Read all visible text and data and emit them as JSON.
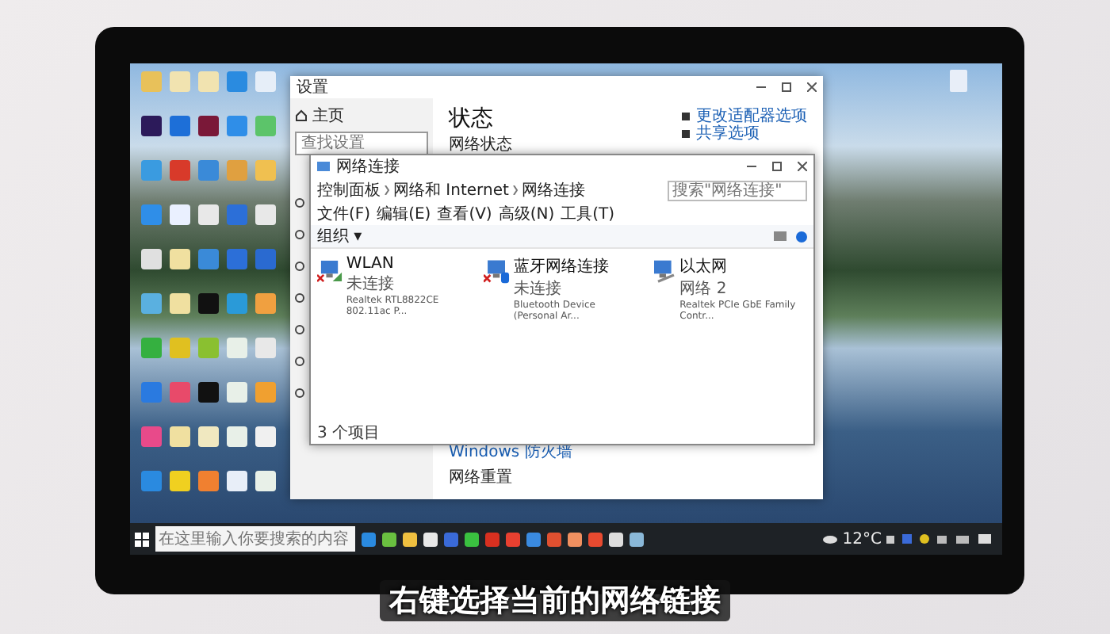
{
  "settings_window": {
    "title": "设置",
    "home": "主页",
    "search_placeholder": "查找设置",
    "heading": "状态",
    "subheading": "网络状态",
    "links": [
      "更改适配器选项",
      "共享选项"
    ],
    "footer_links": [
      "Windows 防火墙",
      "网络重置"
    ]
  },
  "explorer_window": {
    "title": "网络连接",
    "breadcrumb": [
      "控制面板",
      "网络和 Internet",
      "网络连接"
    ],
    "search_placeholder": "搜索\"网络连接\"",
    "menu": [
      "文件(F)",
      "编辑(E)",
      "查看(V)",
      "高级(N)",
      "工具(T)"
    ],
    "toolbar": "组织 ▾",
    "connections": [
      {
        "name": "WLAN",
        "status": "未连接",
        "device": "Realtek RTL8822CE 802.11ac P...",
        "kind": "wifi",
        "disconnected": true
      },
      {
        "name": "蓝牙网络连接",
        "status": "未连接",
        "device": "Bluetooth Device (Personal Ar...",
        "kind": "bluetooth",
        "disconnected": true
      },
      {
        "name": "以太网",
        "status": "网络 2",
        "device": "Realtek PCIe GbE Family Contr...",
        "kind": "ethernet",
        "disconnected": false
      }
    ],
    "status_bar": "3 个项目"
  },
  "taskbar": {
    "search_placeholder": "在这里输入你要搜索的内容",
    "weather": "12°C"
  },
  "caption": "右键选择当前的网络链接"
}
